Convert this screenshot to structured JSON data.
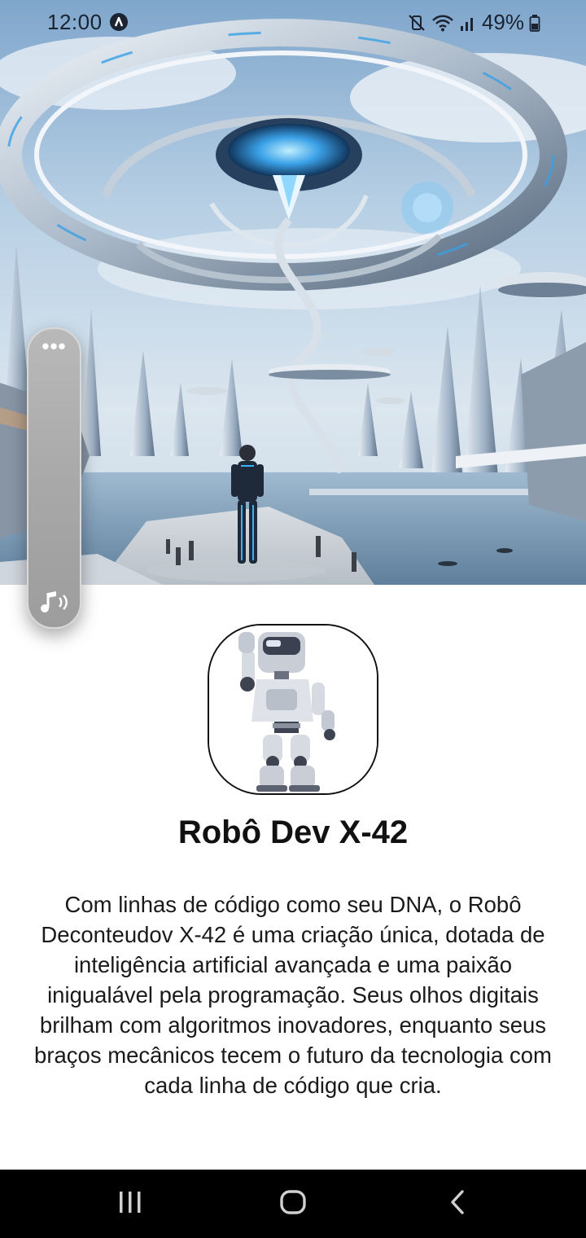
{
  "status_bar": {
    "time": "12:00",
    "battery_percent": "49%",
    "icons": [
      "auto-a-icon",
      "mute-vibrate-icon",
      "wifi-icon",
      "signal-icon",
      "battery-icon"
    ]
  },
  "hero": {
    "icon": "futuristic-city-image"
  },
  "sound_panel": {
    "more_label": "•••",
    "icon": "sound-icon"
  },
  "profile": {
    "avatar_icon": "robot-avatar-image",
    "title": "Robô Dev X-42",
    "description": "Com linhas de código como seu DNA, o Robô Deconteudov X-42 é uma criação única, dotada de inteligência artificial avançada e uma paixão inigualável pela programação. Seus olhos digitais brilham com algoritmos inovadores, enquanto seus braços mecânicos tecem o futuro da tecnologia com cada linha de código que cria."
  },
  "nav_bar": {
    "icons": [
      "recents-icon",
      "home-icon",
      "back-icon"
    ]
  },
  "colors": {
    "nav_bg": "#000000",
    "text": "#111111",
    "panel": "#a6a6a6"
  }
}
